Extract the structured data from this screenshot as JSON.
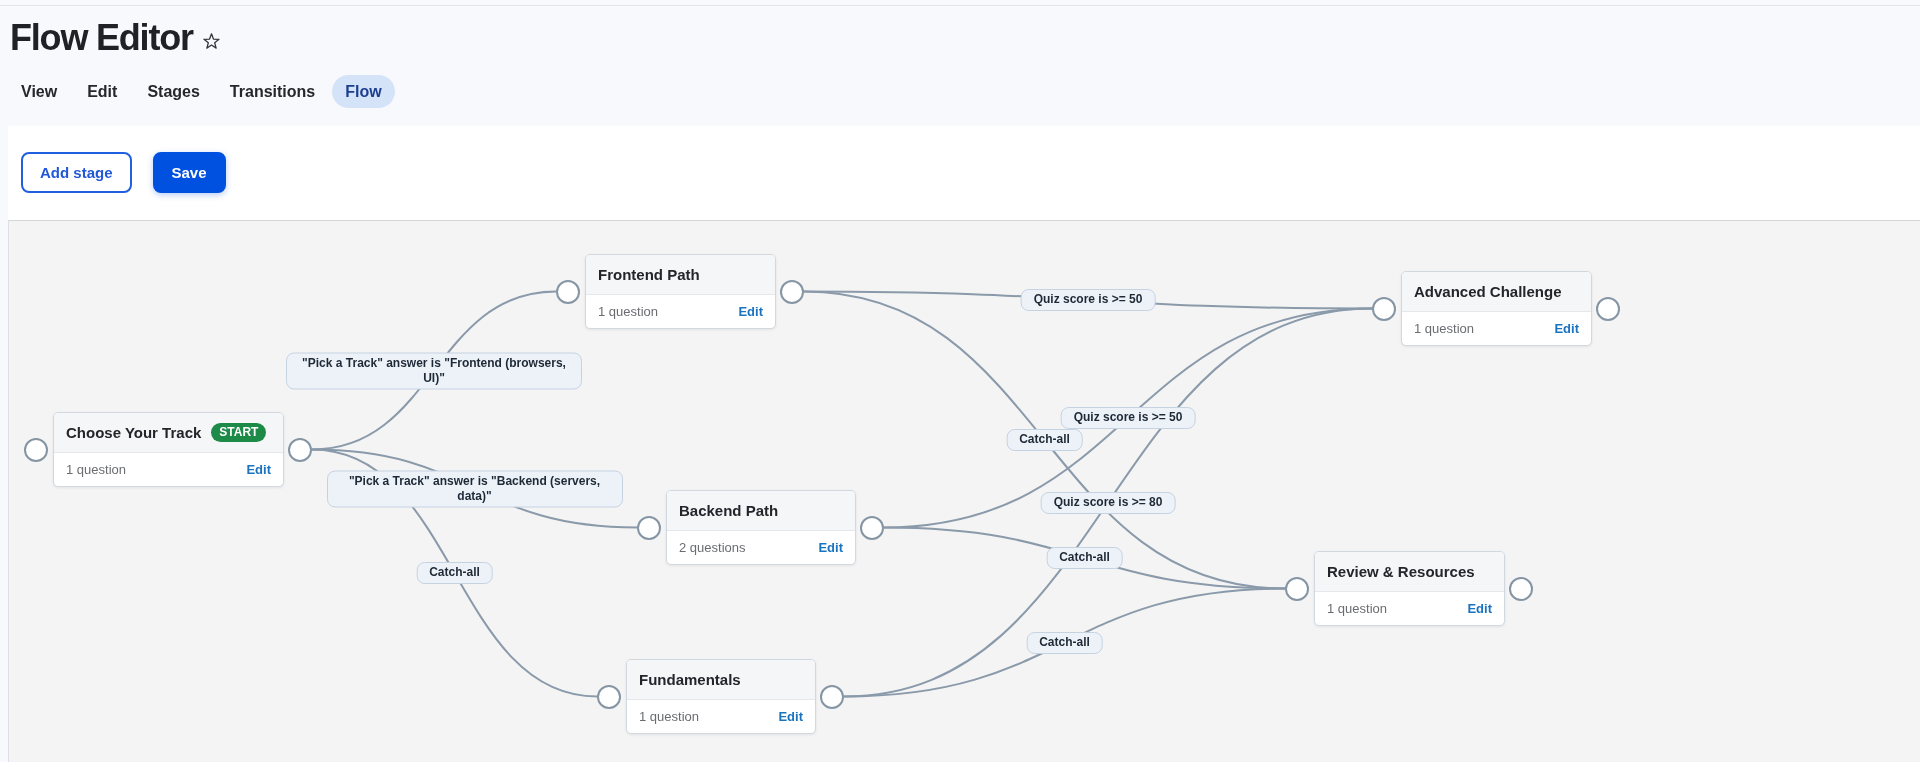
{
  "page": {
    "title": "Flow Editor"
  },
  "tabs": [
    {
      "label": "View",
      "selected": false
    },
    {
      "label": "Edit",
      "selected": false
    },
    {
      "label": "Stages",
      "selected": false
    },
    {
      "label": "Transitions",
      "selected": false
    },
    {
      "label": "Flow",
      "selected": true
    }
  ],
  "toolbar": {
    "buttons": [
      {
        "label": "Add stage",
        "kind": "outline"
      },
      {
        "label": "Save",
        "kind": "primary"
      }
    ]
  },
  "flow": {
    "stages": [
      {
        "title": "Choose Your Track",
        "badge": "START",
        "questions": "1 question",
        "action": "Edit"
      },
      {
        "title": "Frontend Path",
        "questions": "1 question",
        "action": "Edit"
      },
      {
        "title": "Backend Path",
        "questions": "2 questions",
        "action": "Edit"
      },
      {
        "title": "Fundamentals",
        "questions": "1 question",
        "action": "Edit"
      },
      {
        "title": "Advanced Challenge",
        "questions": "1 question",
        "action": "Edit"
      },
      {
        "title": "Review & Resources",
        "questions": "1 question",
        "action": "Edit"
      }
    ],
    "transitions": [
      {
        "label": "Quiz score is >= 50"
      },
      {
        "label": "\"Pick a Track\" answer is \"Frontend (browsers, UI)\""
      },
      {
        "label": "Quiz score is >= 50"
      },
      {
        "label": "Catch-all"
      },
      {
        "label": "\"Pick a Track\" answer is \"Backend (servers, data)\""
      },
      {
        "label": "Quiz score is >= 80"
      },
      {
        "label": "Catch-all"
      },
      {
        "label": "Catch-all"
      },
      {
        "label": "Catch-all"
      }
    ]
  }
}
